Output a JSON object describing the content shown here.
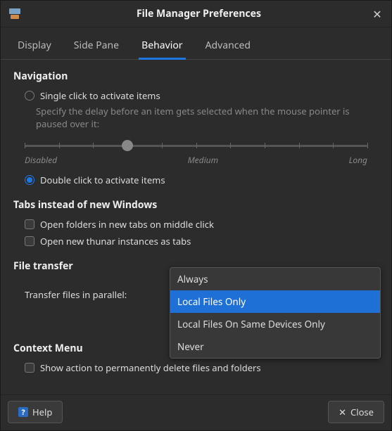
{
  "window": {
    "title": "File Manager Preferences"
  },
  "tabs": {
    "items": [
      {
        "label": "Display"
      },
      {
        "label": "Side Pane"
      },
      {
        "label": "Behavior"
      },
      {
        "label": "Advanced"
      }
    ],
    "active_index": 2
  },
  "navigation": {
    "title": "Navigation",
    "single_click": {
      "label": "Single click to activate items",
      "checked": false
    },
    "delay_help": "Specify the delay before an item gets selected when the mouse pointer is paused over it:",
    "slider": {
      "labels": {
        "min": "Disabled",
        "mid": "Medium",
        "max": "Long"
      },
      "value_pct": 30
    },
    "double_click": {
      "label": "Double click to activate items",
      "checked": true
    }
  },
  "tabs_section": {
    "title": "Tabs instead of new Windows",
    "middle_click": {
      "label": "Open folders in new tabs on middle click",
      "checked": false
    },
    "new_instances": {
      "label": "Open new thunar instances as tabs",
      "checked": false
    }
  },
  "file_transfer": {
    "title": "File transfer",
    "label": "Transfer files in parallel:",
    "options": [
      "Always",
      "Local Files Only",
      "Local Files On Same Devices Only",
      "Never"
    ],
    "selected_index": 1
  },
  "context_menu": {
    "title": "Context Menu",
    "perm_delete": {
      "label": "Show action to permanently delete files and folders",
      "checked": false
    }
  },
  "footer": {
    "help": "Help",
    "close": "Close"
  }
}
